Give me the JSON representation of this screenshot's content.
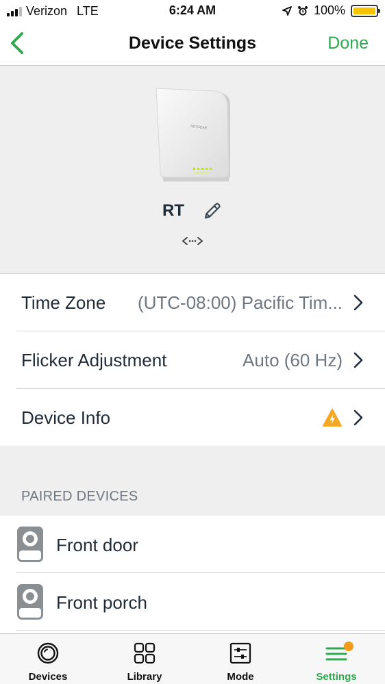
{
  "status_bar": {
    "carrier": "Verizon",
    "network": "LTE",
    "time": "6:24 AM",
    "battery": "100%"
  },
  "nav": {
    "title": "Device Settings",
    "done_label": "Done",
    "back_icon": "chevron-left-icon"
  },
  "device": {
    "name": "RT",
    "brand_label": "NETGEAR",
    "edit_icon": "pencil-icon",
    "connection_icon": "connection-arrows-icon"
  },
  "settings": [
    {
      "label": "Time Zone",
      "value": "(UTC-08:00) Pacific Tim..."
    },
    {
      "label": "Flicker Adjustment",
      "value": "Auto (60 Hz)"
    },
    {
      "label": "Device Info",
      "value": "",
      "status_icon": "warning-icon"
    }
  ],
  "paired_section": {
    "header": "PAIRED DEVICES",
    "items": [
      {
        "label": "Front door"
      },
      {
        "label": "Front porch"
      }
    ]
  },
  "tabs": [
    {
      "label": "Devices",
      "icon": "camera-lens-icon",
      "active": false
    },
    {
      "label": "Library",
      "icon": "grid-icon",
      "active": false
    },
    {
      "label": "Mode",
      "icon": "sliders-icon",
      "active": false
    },
    {
      "label": "Settings",
      "icon": "menu-icon",
      "active": true
    }
  ],
  "colors": {
    "accent": "#2fa84f",
    "warning": "#f5a623",
    "badge": "#f39a1d",
    "battery": "#f7c500"
  }
}
